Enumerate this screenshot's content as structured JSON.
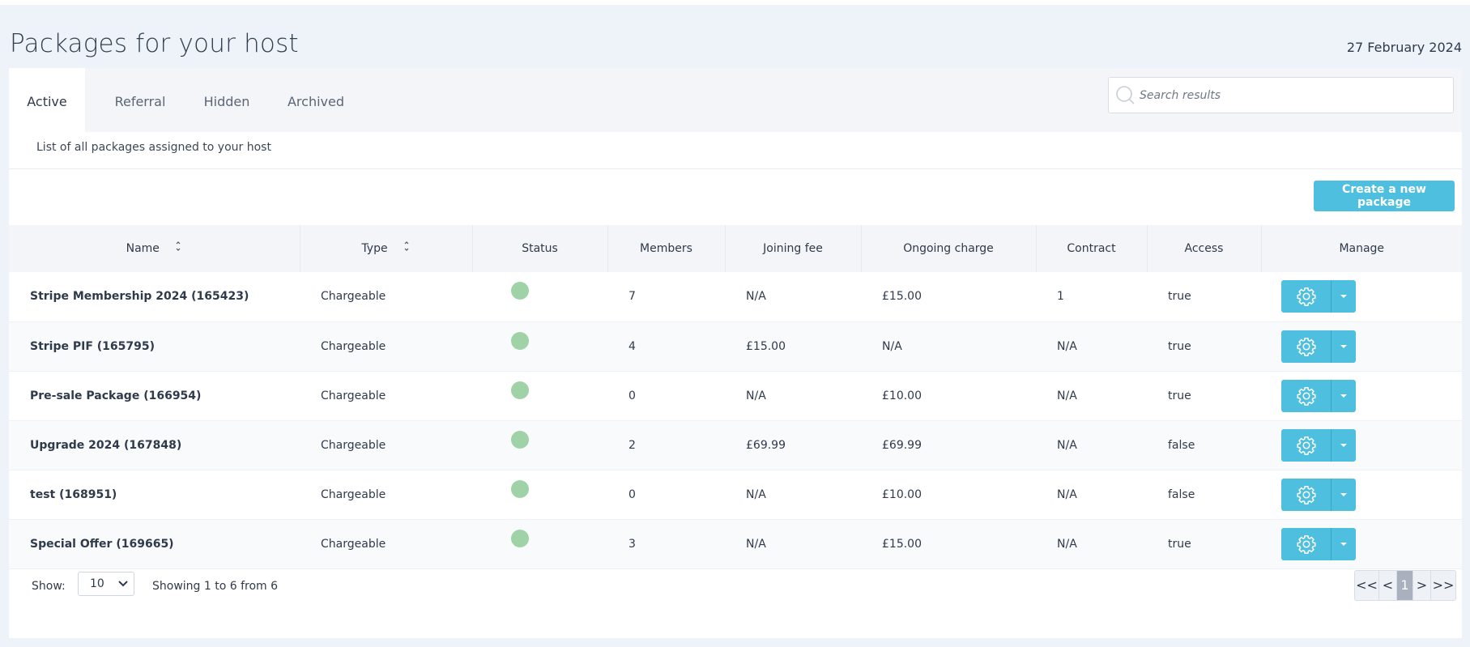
{
  "header": {
    "title": "Packages for your host",
    "date": "27 February 2024"
  },
  "tabs": [
    {
      "label": "Active",
      "active": true
    },
    {
      "label": "Referral",
      "active": false
    },
    {
      "label": "Hidden",
      "active": false
    },
    {
      "label": "Archived",
      "active": false
    }
  ],
  "search": {
    "placeholder": "Search results",
    "value": ""
  },
  "subtitle": "List of all packages assigned to your host",
  "create_button": "Create a new package",
  "table": {
    "columns": [
      "Name",
      "Type",
      "Status",
      "Members",
      "Joining fee",
      "Ongoing charge",
      "Contract",
      "Access",
      "Manage"
    ],
    "rows": [
      {
        "name": "Stripe Membership 2024 (165423)",
        "type": "Chargeable",
        "status": "active",
        "members": "7",
        "joining_fee": "N/A",
        "ongoing_charge": "£15.00",
        "contract": "1",
        "access": "true"
      },
      {
        "name": "Stripe PIF (165795)",
        "type": "Chargeable",
        "status": "active",
        "members": "4",
        "joining_fee": "£15.00",
        "ongoing_charge": "N/A",
        "contract": "N/A",
        "access": "true"
      },
      {
        "name": "Pre-sale Package (166954)",
        "type": "Chargeable",
        "status": "active",
        "members": "0",
        "joining_fee": "N/A",
        "ongoing_charge": "£10.00",
        "contract": "N/A",
        "access": "true"
      },
      {
        "name": "Upgrade 2024 (167848)",
        "type": "Chargeable",
        "status": "active",
        "members": "2",
        "joining_fee": "£69.99",
        "ongoing_charge": "£69.99",
        "contract": "N/A",
        "access": "false"
      },
      {
        "name": "test (168951)",
        "type": "Chargeable",
        "status": "active",
        "members": "0",
        "joining_fee": "N/A",
        "ongoing_charge": "£10.00",
        "contract": "N/A",
        "access": "false"
      },
      {
        "name": "Special Offer (169665)",
        "type": "Chargeable",
        "status": "active",
        "members": "3",
        "joining_fee": "N/A",
        "ongoing_charge": "£15.00",
        "contract": "N/A",
        "access": "true"
      }
    ]
  },
  "footer": {
    "show_label": "Show:",
    "page_size": "10",
    "showing_text": "Showing 1 to 6 from 6",
    "pager": {
      "first": "<<",
      "prev": "<",
      "current": "1",
      "next": ">",
      "last": ">>"
    }
  },
  "colors": {
    "accent": "#4fbfe0",
    "status_active": "#9fd2a6",
    "page_bg": "#eef3f9"
  },
  "icons": {
    "search": "search-icon",
    "sort": "sort-icon",
    "status": "status-dot",
    "gear": "gear-icon",
    "caret": "caret-down-icon",
    "select": "chevron-down-icon"
  }
}
